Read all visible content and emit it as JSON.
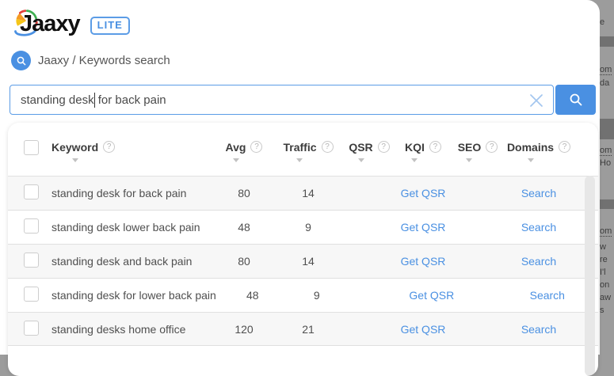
{
  "brand": {
    "logo_text": "Jaaxy",
    "badge_label": "LITE"
  },
  "breadcrumb": {
    "label": "Jaaxy / Keywords search"
  },
  "search": {
    "text_before_caret": "standing desk",
    "text_after_caret": " for back pain",
    "full_value": "standing desk for back pain"
  },
  "icons": {
    "breadcrumb": "search-icon",
    "clear": "x-icon",
    "submit": "search-icon"
  },
  "colors": {
    "accent_blue": "#4a90e2",
    "link_blue": "#4a90e2",
    "alt_row_bg": "#f7f7f7"
  },
  "table": {
    "help_glyph": "?",
    "headers": [
      {
        "id": "keyword",
        "label": "Keyword"
      },
      {
        "id": "avg",
        "label": "Avg"
      },
      {
        "id": "traffic",
        "label": "Traffic"
      },
      {
        "id": "qsr",
        "label": "QSR"
      },
      {
        "id": "kqi",
        "label": "KQI"
      },
      {
        "id": "seo",
        "label": "SEO"
      },
      {
        "id": "domains",
        "label": "Domains"
      }
    ],
    "rows": [
      {
        "keyword": "standing desk for back pain",
        "avg": "80",
        "traffic": "14",
        "qsr_action": "Get QSR",
        "domains_action": "Search"
      },
      {
        "keyword": "standing desk lower back pain",
        "avg": "48",
        "traffic": "9",
        "qsr_action": "Get QSR",
        "domains_action": "Search"
      },
      {
        "keyword": "standing desk and back pain",
        "avg": "80",
        "traffic": "14",
        "qsr_action": "Get QSR",
        "domains_action": "Search"
      },
      {
        "keyword": "standing desk for lower back pain",
        "avg": "48",
        "traffic": "9",
        "qsr_action": "Get QSR",
        "domains_action": "Search"
      },
      {
        "keyword": "standing desks home office",
        "avg": "120",
        "traffic": "21",
        "qsr_action": "Get QSR",
        "domains_action": "Search"
      }
    ]
  },
  "background_page": {
    "fragments": [
      "e",
      "om",
      "da",
      "om",
      "Ho",
      "om",
      "w",
      "re",
      "I'l",
      "on",
      "aw",
      "s"
    ]
  }
}
